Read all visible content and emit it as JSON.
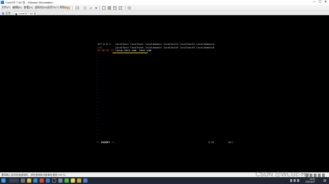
{
  "window": {
    "title": "CentOS 7 64 位 - VMware Workstation",
    "controls": {
      "minimize": "─",
      "maximize": "☐",
      "close": "✕"
    }
  },
  "menu": {
    "items": [
      "文件(F)",
      "编辑(E)",
      "查看(V)",
      "虚拟机(M)",
      "选项卡(T)",
      "帮助(H)"
    ]
  },
  "toolbar": {
    "icons": [
      "pause-icon",
      "send-ctrl-alt-del-icon",
      "snapshot-icon",
      "revert-snapshot-icon",
      "snapshot-manager-icon",
      "fullscreen-icon",
      "unity-icon",
      "console-view-icon",
      "stretch-icon",
      "settings-icon"
    ]
  },
  "tabs": [
    {
      "label": "主页",
      "icon": "home-icon"
    },
    {
      "label": "CentOS 7 64 位",
      "icon": "vm-icon",
      "close": "×"
    }
  ],
  "terminal": {
    "lines": [
      "127.0.0.1   localhost localhost.localdomain localhost4 localhost4.localdomain4",
      "::1         localhost localhost.localdomain localhost6 localhost6.localdomain6"
    ],
    "prompt": "20.88.85.73",
    "command": " linux.test.com  test.com",
    "tilde": "~",
    "mode": "-- INSERT --",
    "position": "3,37",
    "percent": "All"
  },
  "vmhint": {
    "text": "要将输入定向到该虚拟机，请在虚拟机内部单击或按 Ctrl+G。"
  },
  "watermark": "CSDN @WLGc-Hu",
  "taskbar": {
    "apps": [
      "windows-start-icon",
      "task-view-icon",
      "file-explorer-icon",
      "edge-icon",
      "chrome-icon",
      "vscode-icon",
      "terminal-icon",
      "vmware-icon",
      "wechat-icon",
      "notes-icon",
      "folder-icon",
      "mail-icon"
    ],
    "clock": "16:21",
    "date": "2022/6/27"
  },
  "colors": {
    "console_bg": "#000000",
    "tilde": "#3a3ad8",
    "prompt_red": "#ff4646",
    "underline_yellow": "#e6c418",
    "taskbar_bg": "#1f2733"
  }
}
